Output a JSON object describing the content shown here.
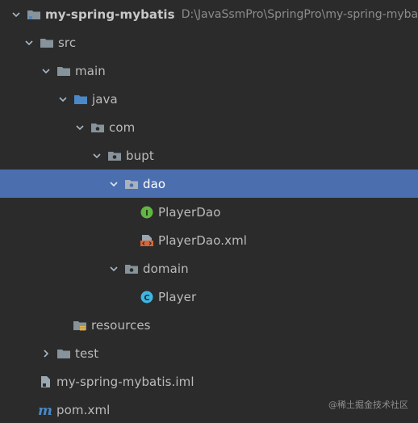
{
  "project_tree": {
    "root": {
      "name": "my-spring-mybatis",
      "path": "D:\\JavaSsmPro\\SpringPro\\my-spring-mybat",
      "icon": "module-folder-icon"
    },
    "items": [
      {
        "label": "src",
        "icon": "folder-icon"
      },
      {
        "label": "main",
        "icon": "folder-icon"
      },
      {
        "label": "java",
        "icon": "source-folder-icon"
      },
      {
        "label": "com",
        "icon": "package-icon"
      },
      {
        "label": "bupt",
        "icon": "package-icon"
      },
      {
        "label": "dao",
        "icon": "package-icon",
        "selected": true
      },
      {
        "label": "PlayerDao",
        "icon": "interface-icon"
      },
      {
        "label": "PlayerDao.xml",
        "icon": "xml-file-icon"
      },
      {
        "label": "domain",
        "icon": "package-icon"
      },
      {
        "label": "Player",
        "icon": "class-icon"
      },
      {
        "label": "resources",
        "icon": "resources-folder-icon"
      },
      {
        "label": "test",
        "icon": "folder-icon",
        "collapsed": true
      },
      {
        "label": "my-spring-mybatis.iml",
        "icon": "iml-file-icon"
      },
      {
        "label": "pom.xml",
        "icon": "maven-icon"
      }
    ]
  },
  "glyphs": {
    "interface": "I",
    "class": "C",
    "maven": "m"
  },
  "watermark": "@稀土掘金技术社区",
  "colors": {
    "background": "#2b2b2b",
    "selection": "#4b6eaf",
    "folder": "#87939a",
    "source_folder": "#4a88c7",
    "interface": "#62b543",
    "class": "#40b6e0",
    "xml": "#d86637"
  }
}
